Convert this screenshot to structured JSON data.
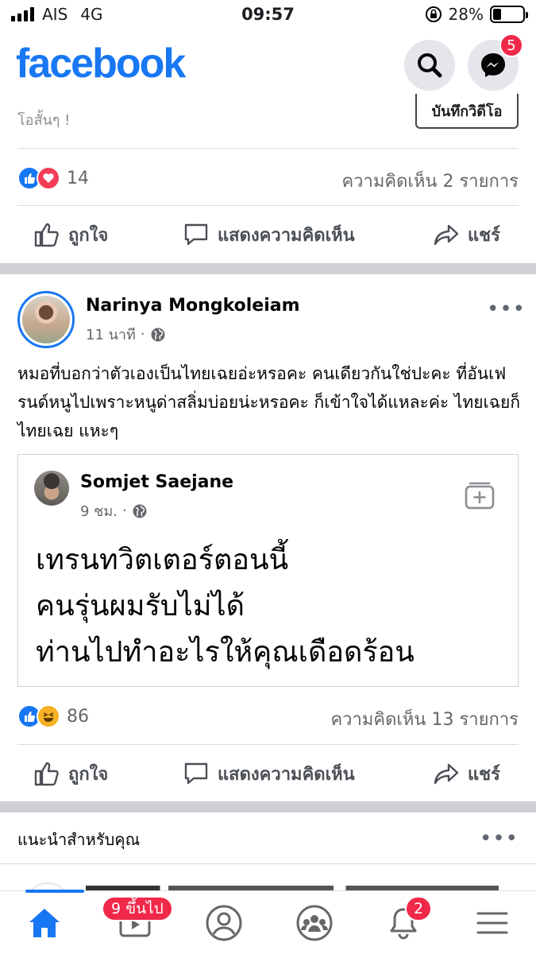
{
  "status_bar": {
    "carrier": "AIS",
    "network": "4G",
    "time": "09:57",
    "battery": "28%",
    "battery_level": 0.28
  },
  "header": {
    "logo": "facebook",
    "search_icon": "search-icon",
    "messenger_icon": "messenger-icon",
    "messenger_badge": "5"
  },
  "previous_post": {
    "text_partial": "โอสั้นๆ !",
    "record_button": "บันทึกวิดีโอ",
    "reaction_count": "14",
    "reactions": [
      "like",
      "love"
    ],
    "comments": "ความคิดเห็น 2 รายการ"
  },
  "actions": {
    "like": "ถูกใจ",
    "comment": "แสดงความคิดเห็น",
    "share": "แชร์"
  },
  "post": {
    "author": "Narinya Mongkoleiam",
    "time": "11 นาที",
    "separator": "·",
    "privacy_icon": "globe-icon",
    "text": "หมอที่บอกว่าตัวเองเป็นไทยเฉยอ่ะหรอคะ คนเดียวกันใช่ปะคะ ที่อันเฟรนด์หนูไปเพราะหนูด่าสลิ่มบ่อยน่ะหรอคะ ก็เข้าใจได้แหละค่ะ ไทยเฉยก็ไทยเฉย แหะๆ",
    "shared": {
      "author": "Somjet Saejane",
      "time": "9 ชม.",
      "separator": "·",
      "lines": [
        "เทรนทวิตเตอร์ตอนนี้",
        "คนรุ่นผมรับไม่ได้",
        "ท่านไปทำอะไรให้คุณเดือดร้อน"
      ]
    },
    "reaction_count": "86",
    "reactions": [
      "like",
      "haha"
    ],
    "comments": "ความคิดเห็น 13 รายการ"
  },
  "suggestions": {
    "title": "แนะนำสำหรับคุณ"
  },
  "tab_bar": {
    "watch_badge": "9 ขึ้นไป",
    "notifications_badge": "2"
  },
  "colors": {
    "brand": "#1877f2",
    "badge": "#f02849",
    "secondary_text": "#65676b"
  }
}
